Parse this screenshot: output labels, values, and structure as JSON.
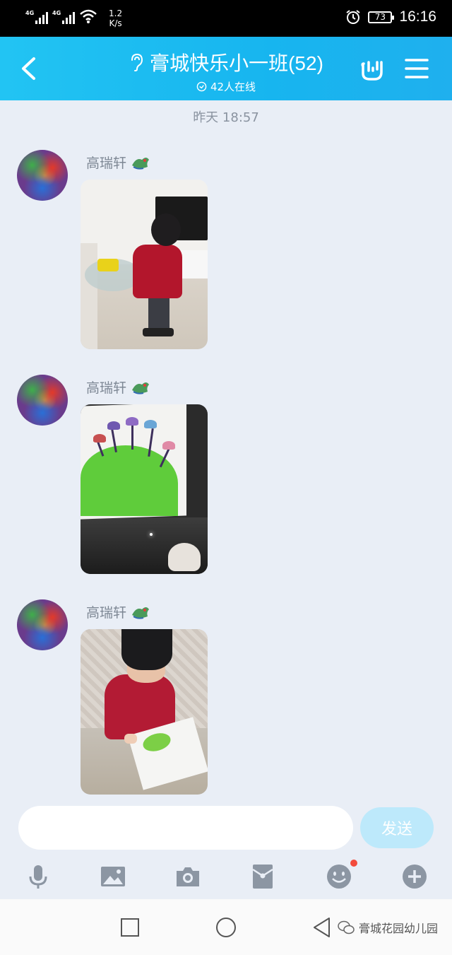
{
  "status_bar": {
    "network1": "4G",
    "network2": "4G",
    "speed_value": "1.2",
    "speed_unit": "K/s",
    "battery": "73",
    "time": "16:16"
  },
  "header": {
    "title": "膏城快乐小一班(52)",
    "online": "42人在线",
    "back_icon": "chevron-left-icon",
    "hand_icon": "rock-hand-icon",
    "menu_icon": "menu-icon"
  },
  "chat": {
    "timestamp": "昨天 18:57",
    "messages": [
      {
        "sender": "高瑞轩",
        "photo": "boy-living-room"
      },
      {
        "sender": "高瑞轩",
        "photo": "mushroom-drawing"
      },
      {
        "sender": "高瑞轩",
        "photo": "boy-drawing"
      }
    ]
  },
  "input": {
    "value": "",
    "placeholder": "",
    "send_label": "发送",
    "send_color": "#bde9fb"
  },
  "toolbar": {
    "items": [
      "microphone-icon",
      "image-icon",
      "camera-icon",
      "red-packet-icon",
      "emoji-icon",
      "plus-icon"
    ]
  },
  "navbar": {
    "watermark": "膏城花园幼儿园"
  },
  "colors": {
    "header": "#17b5ef",
    "background": "#e9eef6",
    "icon_gray": "#8c96a3"
  }
}
